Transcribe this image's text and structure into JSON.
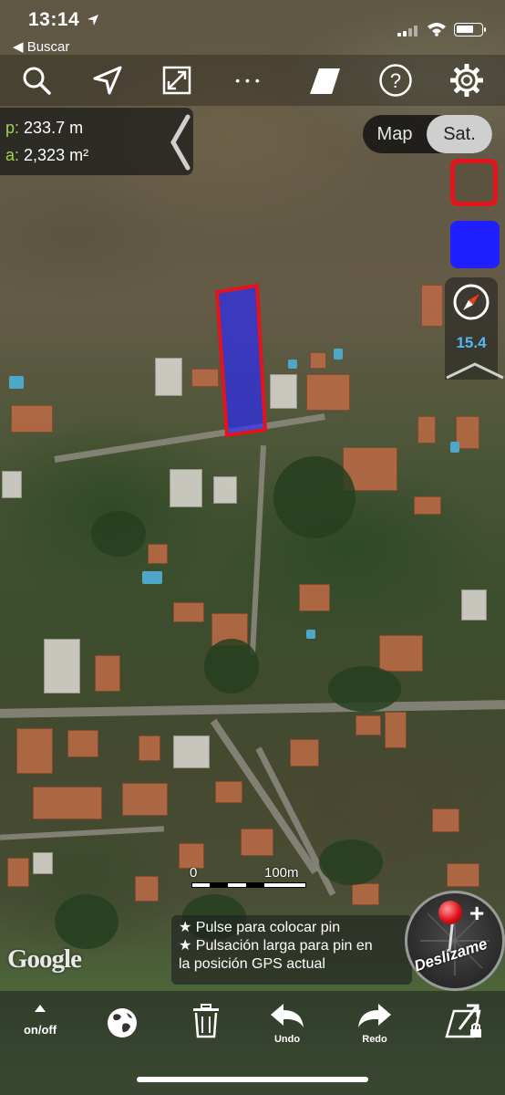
{
  "status_bar": {
    "time": "13:14",
    "back_label": "◀ Buscar"
  },
  "toolbar": {
    "items": [
      "search-icon",
      "navigate-icon",
      "fullscreen-icon",
      "more-icon",
      "shape-icon",
      "help-icon",
      "gear-icon"
    ],
    "more_label": "• • •",
    "help_label": "?"
  },
  "measurement": {
    "perimeter_key": "p:",
    "perimeter_value": "233.7 m",
    "area_key": "a:",
    "area_value": "2,323 m²"
  },
  "map_type": {
    "options": [
      "Map",
      "Sat."
    ],
    "selected": "Sat."
  },
  "swatches": {
    "stroke_color": "#e3141b",
    "fill_color": "#1f1fff"
  },
  "compass": {
    "zoom_level": "15.4"
  },
  "polygon": {
    "stroke_color": "#e3141b",
    "fill_color": "rgba(40,40,255,0.65)"
  },
  "scale_bar": {
    "zero_label": "0",
    "distance_label": "100m"
  },
  "hint": {
    "line1": "★ Pulse para colocar pin",
    "line2": "★ Pulsación larga para pin en",
    "line3": "la posición GPS actual"
  },
  "attribution": {
    "text": "Google"
  },
  "pin_button": {
    "label": "Deslízame"
  },
  "bottom_bar": {
    "onoff_label": "on/off",
    "undo_label": "Undo",
    "redo_label": "Redo"
  }
}
